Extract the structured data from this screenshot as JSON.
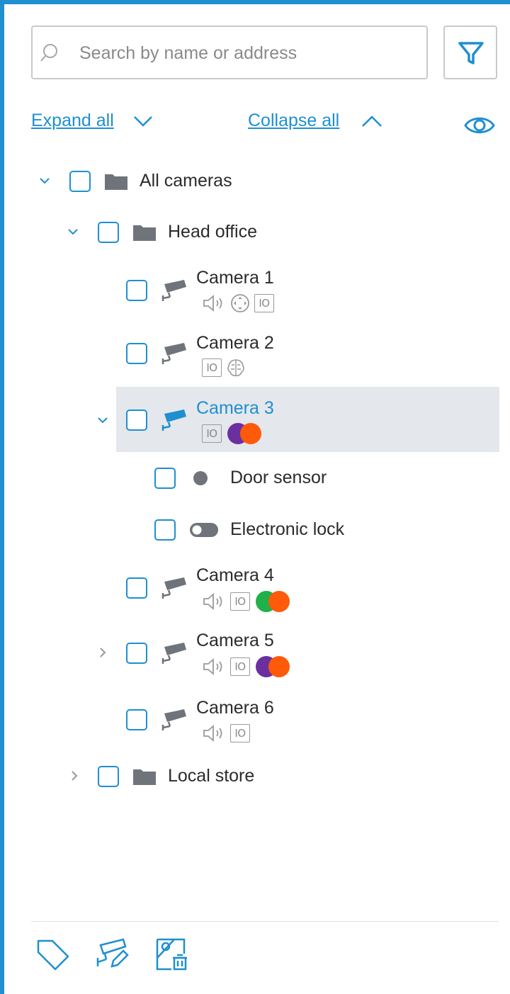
{
  "search": {
    "placeholder": "Search by name or address",
    "value": ""
  },
  "toolbar": {
    "expand_label": "Expand all",
    "collapse_label": "Collapse all"
  },
  "icons": {
    "search": "search-icon",
    "filter": "filter-icon",
    "eye": "eye-icon",
    "tag": "tag-icon",
    "edit_camera": "camera-edit-icon",
    "map_delete": "map-delete-icon"
  },
  "tree": {
    "all_cameras": "All cameras",
    "head_office": "Head office",
    "local_store": "Local store",
    "cameras": [
      {
        "name": "Camera 1"
      },
      {
        "name": "Camera 2"
      },
      {
        "name": "Camera 3",
        "selected": true
      },
      {
        "name": "Camera 4"
      },
      {
        "name": "Camera 5"
      },
      {
        "name": "Camera 6"
      }
    ],
    "door_sensor": "Door sensor",
    "electronic_lock": "Electronic lock",
    "io_label": "IO"
  },
  "colors": {
    "accent": "#1f8fd0",
    "selection": "#e4e7ec",
    "purple": "#6b2fa0",
    "orange": "#ff5a0a",
    "green": "#1fb14a",
    "icon_gray": "#6f747b"
  }
}
